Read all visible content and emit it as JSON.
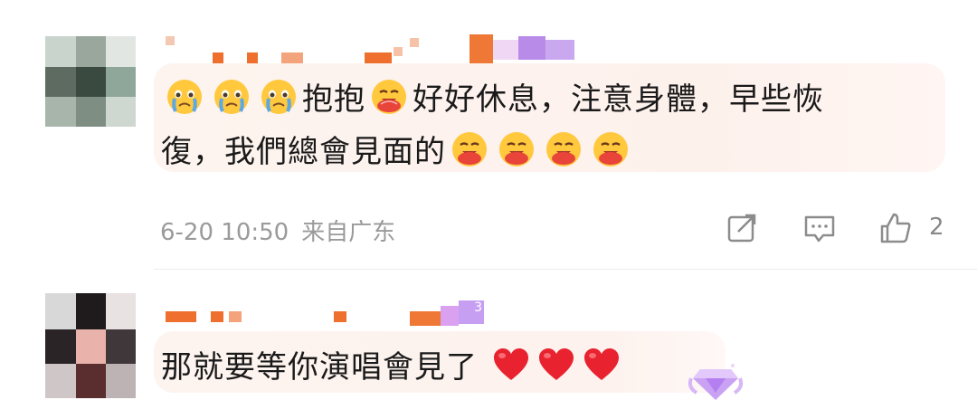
{
  "comments": [
    {
      "text_part1": "抱抱",
      "text_part2": "好好休息，注意身體，早些恢",
      "text_line2": "復，我們總會見面的",
      "timestamp": "6-20 10:50",
      "location": "来自广东",
      "like_count": "2",
      "emoji_icons": [
        "crying-face-icon",
        "hugging-face-icon",
        "heart-icon"
      ]
    },
    {
      "text": "那就要等你演唱會見了",
      "badge_level": "3"
    }
  ],
  "colors": {
    "bubble": "#fdf2ee",
    "meta_text": "#9a9a9a",
    "heart": "#e8222f",
    "name_block_orange": "#f07a3a",
    "name_block_purple": "#b98be8"
  }
}
